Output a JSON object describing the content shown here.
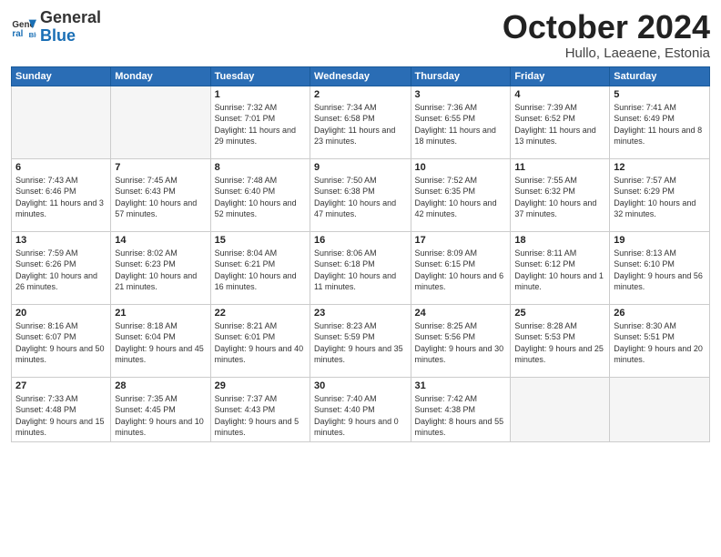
{
  "logo": {
    "general": "General",
    "blue": "Blue"
  },
  "header": {
    "month": "October 2024",
    "location": "Hullo, Laeaene, Estonia"
  },
  "weekdays": [
    "Sunday",
    "Monday",
    "Tuesday",
    "Wednesday",
    "Thursday",
    "Friday",
    "Saturday"
  ],
  "weeks": [
    [
      {
        "day": "",
        "sunrise": "",
        "sunset": "",
        "daylight": ""
      },
      {
        "day": "",
        "sunrise": "",
        "sunset": "",
        "daylight": ""
      },
      {
        "day": "1",
        "sunrise": "Sunrise: 7:32 AM",
        "sunset": "Sunset: 7:01 PM",
        "daylight": "Daylight: 11 hours and 29 minutes."
      },
      {
        "day": "2",
        "sunrise": "Sunrise: 7:34 AM",
        "sunset": "Sunset: 6:58 PM",
        "daylight": "Daylight: 11 hours and 23 minutes."
      },
      {
        "day": "3",
        "sunrise": "Sunrise: 7:36 AM",
        "sunset": "Sunset: 6:55 PM",
        "daylight": "Daylight: 11 hours and 18 minutes."
      },
      {
        "day": "4",
        "sunrise": "Sunrise: 7:39 AM",
        "sunset": "Sunset: 6:52 PM",
        "daylight": "Daylight: 11 hours and 13 minutes."
      },
      {
        "day": "5",
        "sunrise": "Sunrise: 7:41 AM",
        "sunset": "Sunset: 6:49 PM",
        "daylight": "Daylight: 11 hours and 8 minutes."
      }
    ],
    [
      {
        "day": "6",
        "sunrise": "Sunrise: 7:43 AM",
        "sunset": "Sunset: 6:46 PM",
        "daylight": "Daylight: 11 hours and 3 minutes."
      },
      {
        "day": "7",
        "sunrise": "Sunrise: 7:45 AM",
        "sunset": "Sunset: 6:43 PM",
        "daylight": "Daylight: 10 hours and 57 minutes."
      },
      {
        "day": "8",
        "sunrise": "Sunrise: 7:48 AM",
        "sunset": "Sunset: 6:40 PM",
        "daylight": "Daylight: 10 hours and 52 minutes."
      },
      {
        "day": "9",
        "sunrise": "Sunrise: 7:50 AM",
        "sunset": "Sunset: 6:38 PM",
        "daylight": "Daylight: 10 hours and 47 minutes."
      },
      {
        "day": "10",
        "sunrise": "Sunrise: 7:52 AM",
        "sunset": "Sunset: 6:35 PM",
        "daylight": "Daylight: 10 hours and 42 minutes."
      },
      {
        "day": "11",
        "sunrise": "Sunrise: 7:55 AM",
        "sunset": "Sunset: 6:32 PM",
        "daylight": "Daylight: 10 hours and 37 minutes."
      },
      {
        "day": "12",
        "sunrise": "Sunrise: 7:57 AM",
        "sunset": "Sunset: 6:29 PM",
        "daylight": "Daylight: 10 hours and 32 minutes."
      }
    ],
    [
      {
        "day": "13",
        "sunrise": "Sunrise: 7:59 AM",
        "sunset": "Sunset: 6:26 PM",
        "daylight": "Daylight: 10 hours and 26 minutes."
      },
      {
        "day": "14",
        "sunrise": "Sunrise: 8:02 AM",
        "sunset": "Sunset: 6:23 PM",
        "daylight": "Daylight: 10 hours and 21 minutes."
      },
      {
        "day": "15",
        "sunrise": "Sunrise: 8:04 AM",
        "sunset": "Sunset: 6:21 PM",
        "daylight": "Daylight: 10 hours and 16 minutes."
      },
      {
        "day": "16",
        "sunrise": "Sunrise: 8:06 AM",
        "sunset": "Sunset: 6:18 PM",
        "daylight": "Daylight: 10 hours and 11 minutes."
      },
      {
        "day": "17",
        "sunrise": "Sunrise: 8:09 AM",
        "sunset": "Sunset: 6:15 PM",
        "daylight": "Daylight: 10 hours and 6 minutes."
      },
      {
        "day": "18",
        "sunrise": "Sunrise: 8:11 AM",
        "sunset": "Sunset: 6:12 PM",
        "daylight": "Daylight: 10 hours and 1 minute."
      },
      {
        "day": "19",
        "sunrise": "Sunrise: 8:13 AM",
        "sunset": "Sunset: 6:10 PM",
        "daylight": "Daylight: 9 hours and 56 minutes."
      }
    ],
    [
      {
        "day": "20",
        "sunrise": "Sunrise: 8:16 AM",
        "sunset": "Sunset: 6:07 PM",
        "daylight": "Daylight: 9 hours and 50 minutes."
      },
      {
        "day": "21",
        "sunrise": "Sunrise: 8:18 AM",
        "sunset": "Sunset: 6:04 PM",
        "daylight": "Daylight: 9 hours and 45 minutes."
      },
      {
        "day": "22",
        "sunrise": "Sunrise: 8:21 AM",
        "sunset": "Sunset: 6:01 PM",
        "daylight": "Daylight: 9 hours and 40 minutes."
      },
      {
        "day": "23",
        "sunrise": "Sunrise: 8:23 AM",
        "sunset": "Sunset: 5:59 PM",
        "daylight": "Daylight: 9 hours and 35 minutes."
      },
      {
        "day": "24",
        "sunrise": "Sunrise: 8:25 AM",
        "sunset": "Sunset: 5:56 PM",
        "daylight": "Daylight: 9 hours and 30 minutes."
      },
      {
        "day": "25",
        "sunrise": "Sunrise: 8:28 AM",
        "sunset": "Sunset: 5:53 PM",
        "daylight": "Daylight: 9 hours and 25 minutes."
      },
      {
        "day": "26",
        "sunrise": "Sunrise: 8:30 AM",
        "sunset": "Sunset: 5:51 PM",
        "daylight": "Daylight: 9 hours and 20 minutes."
      }
    ],
    [
      {
        "day": "27",
        "sunrise": "Sunrise: 7:33 AM",
        "sunset": "Sunset: 4:48 PM",
        "daylight": "Daylight: 9 hours and 15 minutes."
      },
      {
        "day": "28",
        "sunrise": "Sunrise: 7:35 AM",
        "sunset": "Sunset: 4:45 PM",
        "daylight": "Daylight: 9 hours and 10 minutes."
      },
      {
        "day": "29",
        "sunrise": "Sunrise: 7:37 AM",
        "sunset": "Sunset: 4:43 PM",
        "daylight": "Daylight: 9 hours and 5 minutes."
      },
      {
        "day": "30",
        "sunrise": "Sunrise: 7:40 AM",
        "sunset": "Sunset: 4:40 PM",
        "daylight": "Daylight: 9 hours and 0 minutes."
      },
      {
        "day": "31",
        "sunrise": "Sunrise: 7:42 AM",
        "sunset": "Sunset: 4:38 PM",
        "daylight": "Daylight: 8 hours and 55 minutes."
      },
      {
        "day": "",
        "sunrise": "",
        "sunset": "",
        "daylight": ""
      },
      {
        "day": "",
        "sunrise": "",
        "sunset": "",
        "daylight": ""
      }
    ]
  ]
}
